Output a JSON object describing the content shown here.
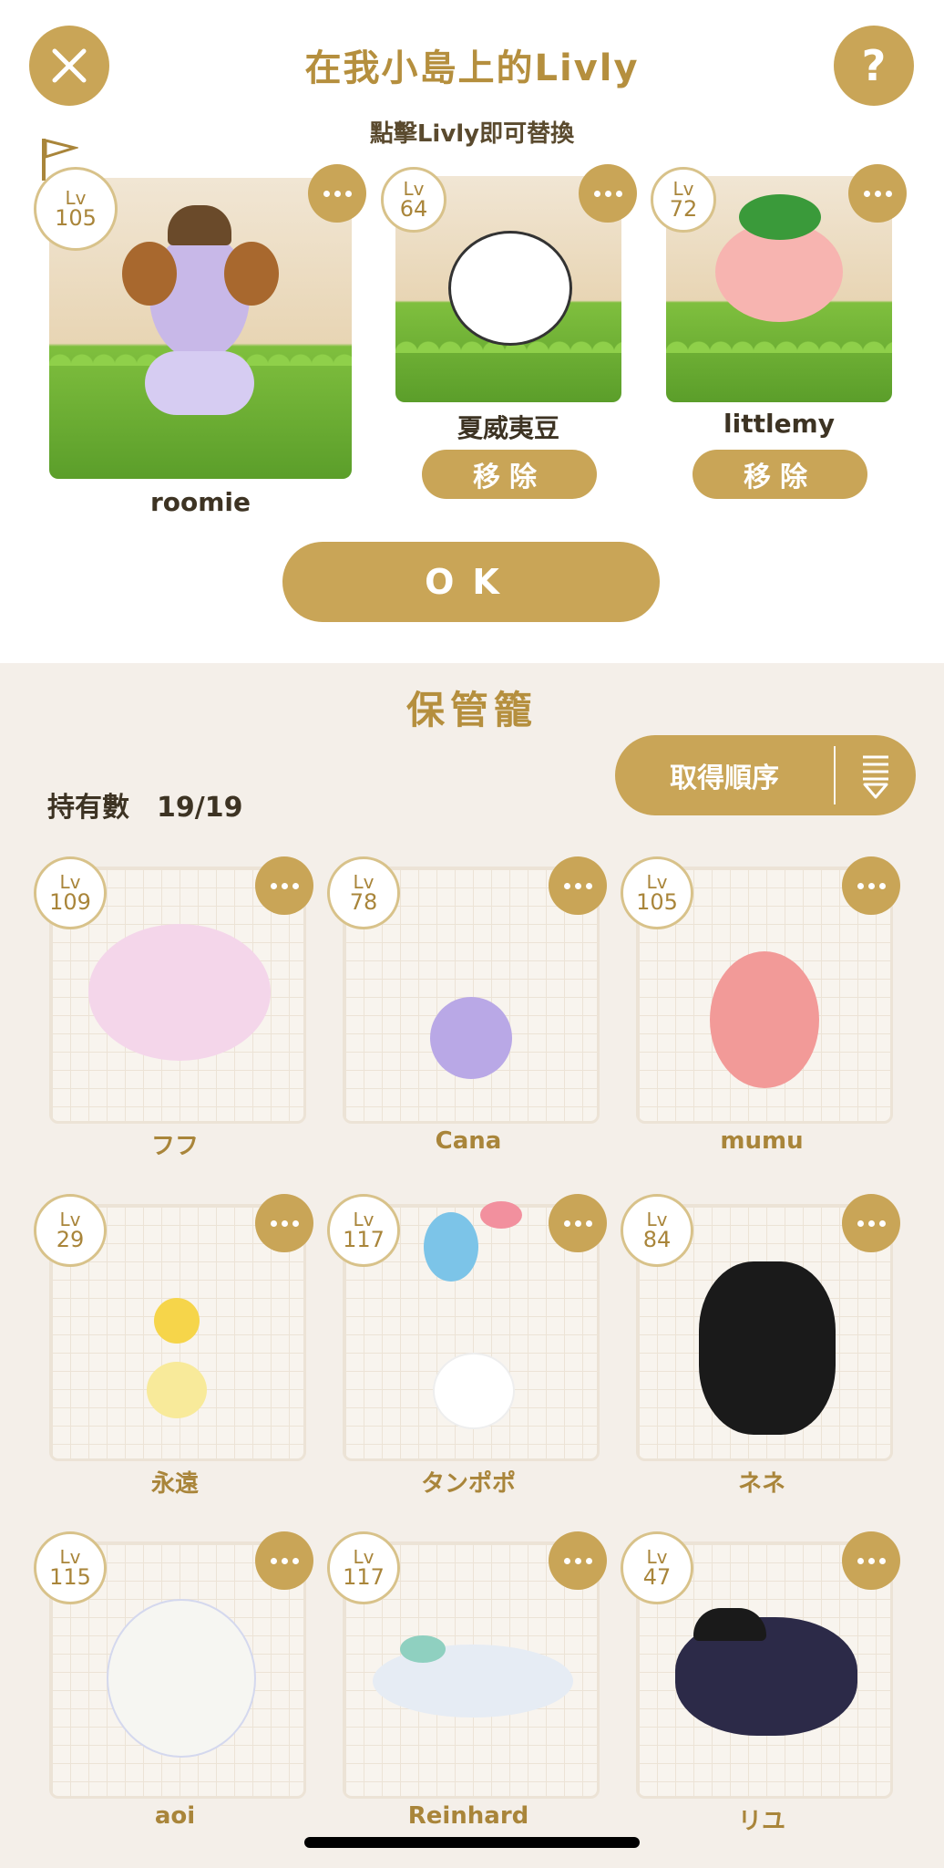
{
  "header": {
    "title": "在我小島上的Livly",
    "subtitle": "點擊Livly即可替換",
    "help_label": "?"
  },
  "island": [
    {
      "lv_label": "Lv",
      "level": "105",
      "name": "roomie",
      "action": ""
    },
    {
      "lv_label": "Lv",
      "level": "64",
      "name": "夏威夷豆",
      "action": "移除"
    },
    {
      "lv_label": "Lv",
      "level": "72",
      "name": "littlemy",
      "action": "移除"
    }
  ],
  "ok_label": "OK",
  "storage": {
    "title": "保管籠",
    "sort_label": "取得順序",
    "count_text": "持有數　19/19",
    "items": [
      {
        "lv_label": "Lv",
        "level": "109",
        "name": "フフ"
      },
      {
        "lv_label": "Lv",
        "level": "78",
        "name": "Cana"
      },
      {
        "lv_label": "Lv",
        "level": "105",
        "name": "mumu"
      },
      {
        "lv_label": "Lv",
        "level": "29",
        "name": "永遠"
      },
      {
        "lv_label": "Lv",
        "level": "117",
        "name": "タンポポ"
      },
      {
        "lv_label": "Lv",
        "level": "84",
        "name": "ネネ"
      },
      {
        "lv_label": "Lv",
        "level": "115",
        "name": "aoi"
      },
      {
        "lv_label": "Lv",
        "level": "117",
        "name": "Reinhard"
      },
      {
        "lv_label": "Lv",
        "level": "47",
        "name": "リユ"
      }
    ]
  },
  "icons": [
    "close-icon",
    "help-icon",
    "flag-icon",
    "more-icon",
    "sort-icon"
  ],
  "colors": {
    "accent": "#c9a557",
    "title": "#b58f3e",
    "background": "#f4efe9"
  }
}
